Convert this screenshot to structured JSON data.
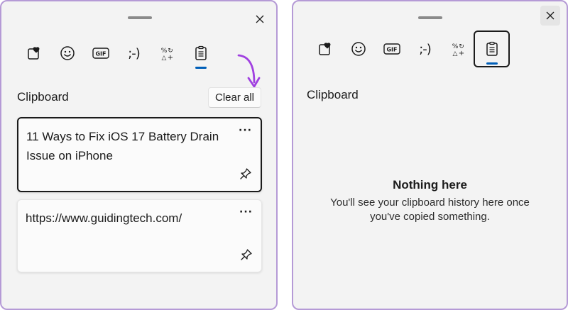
{
  "left_panel": {
    "tabs": [
      {
        "name": "kaomoji-favorites",
        "icon": "heart-card-icon"
      },
      {
        "name": "emoji",
        "icon": "smiley-icon"
      },
      {
        "name": "gif",
        "icon": "gif-icon",
        "label": "GIF"
      },
      {
        "name": "kaomoji",
        "icon": "kaomoji-icon",
        "label": ";-)"
      },
      {
        "name": "symbols",
        "icon": "symbols-icon"
      },
      {
        "name": "clipboard",
        "icon": "clipboard-icon",
        "active": true
      }
    ],
    "section_title": "Clipboard",
    "clear_all_label": "Clear all",
    "items": [
      {
        "text": "11 Ways to Fix iOS 17 Battery Drain Issue on iPhone",
        "selected": true
      },
      {
        "text": "https://www.guidingtech.com/",
        "selected": false
      }
    ],
    "more_label": "···"
  },
  "right_panel": {
    "tabs": [
      {
        "name": "kaomoji-favorites",
        "icon": "heart-card-icon"
      },
      {
        "name": "emoji",
        "icon": "smiley-icon"
      },
      {
        "name": "gif",
        "icon": "gif-icon",
        "label": "GIF"
      },
      {
        "name": "kaomoji",
        "icon": "kaomoji-icon",
        "label": ";-)"
      },
      {
        "name": "symbols",
        "icon": "symbols-icon"
      },
      {
        "name": "clipboard",
        "icon": "clipboard-icon",
        "active": true,
        "focused": true
      }
    ],
    "section_title": "Clipboard",
    "empty_title": "Nothing here",
    "empty_line1": "You'll see your clipboard history here once",
    "empty_line2": "you've copied something."
  },
  "colors": {
    "accent": "#005fb8",
    "annotation": "#a040e0",
    "panel_bg": "#f3f3f3",
    "panel_border": "#b59ad6"
  }
}
